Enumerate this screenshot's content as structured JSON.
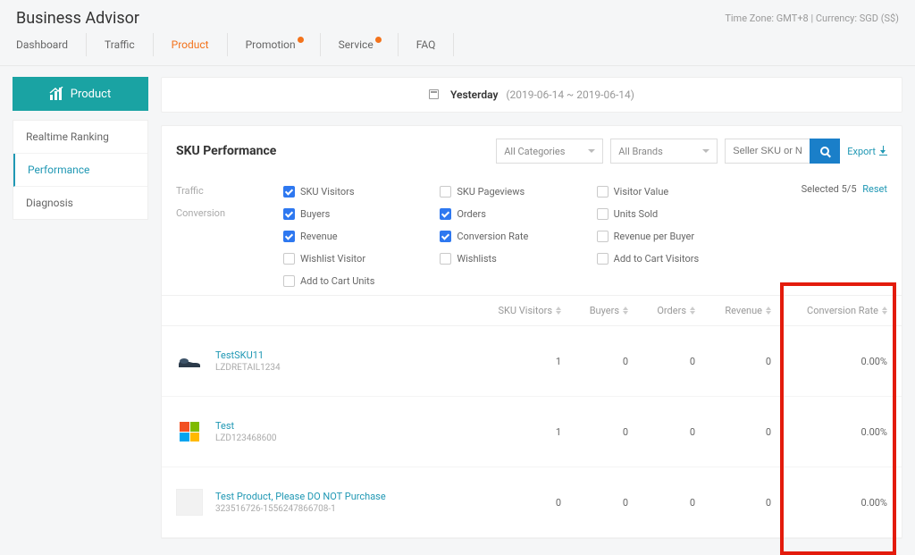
{
  "app_title": "Business Advisor",
  "meta_text": "Time Zone: GMT+8 | Currency: SGD (S$)",
  "mainnav": [
    "Dashboard",
    "Traffic",
    "Product",
    "Promotion",
    "Service",
    "FAQ"
  ],
  "mainnav_active": "Product",
  "mainnav_dots": [
    "Promotion",
    "Service"
  ],
  "sidebar_button": "Product",
  "side_menu": [
    "Realtime Ranking",
    "Performance",
    "Diagnosis"
  ],
  "side_menu_active": "Performance",
  "datebar": {
    "label": "Yesterday",
    "range": "(2019-06-14 ~ 2019-06-14)"
  },
  "panel": {
    "title": "SKU Performance",
    "category_filter": "All Categories",
    "brand_filter": "All Brands",
    "search_placeholder": "Seller SKU or Name",
    "export": "Export"
  },
  "groups": {
    "traffic_label": "Traffic",
    "conversion_label": "Conversion"
  },
  "metrics": {
    "traffic": [
      {
        "label": "SKU Visitors",
        "checked": true
      },
      {
        "label": "SKU Pageviews",
        "checked": false
      },
      {
        "label": "Visitor Value",
        "checked": false
      }
    ],
    "conversion": [
      {
        "label": "Buyers",
        "checked": true
      },
      {
        "label": "Orders",
        "checked": true
      },
      {
        "label": "Units Sold",
        "checked": false
      },
      {
        "label": "Revenue",
        "checked": true
      },
      {
        "label": "Conversion Rate",
        "checked": true
      },
      {
        "label": "Revenue per Buyer",
        "checked": false
      },
      {
        "label": "Wishlist Visitor",
        "checked": false
      },
      {
        "label": "Wishlists",
        "checked": false
      },
      {
        "label": "Add to Cart Visitors",
        "checked": false
      },
      {
        "label": "Add to Cart Units",
        "checked": false
      }
    ]
  },
  "selected_text": "Selected 5/5",
  "reset_text": "Reset",
  "columns": [
    "SKU Visitors",
    "Buyers",
    "Orders",
    "Revenue",
    "Conversion Rate"
  ],
  "rows": [
    {
      "name": "TestSKU11",
      "code": "LZDRETAIL1234",
      "thumb": "shoe",
      "vals": [
        "1",
        "0",
        "0",
        "0",
        "0.00%"
      ]
    },
    {
      "name": "Test",
      "code": "LZD123468600",
      "thumb": "ms",
      "vals": [
        "1",
        "0",
        "0",
        "0",
        "0.00%"
      ]
    },
    {
      "name": "Test Product, Please DO NOT Purchase",
      "code": "323516726-1556247866708-1",
      "thumb": "placeholder",
      "vals": [
        "0",
        "0",
        "0",
        "0",
        "0.00%"
      ]
    }
  ]
}
